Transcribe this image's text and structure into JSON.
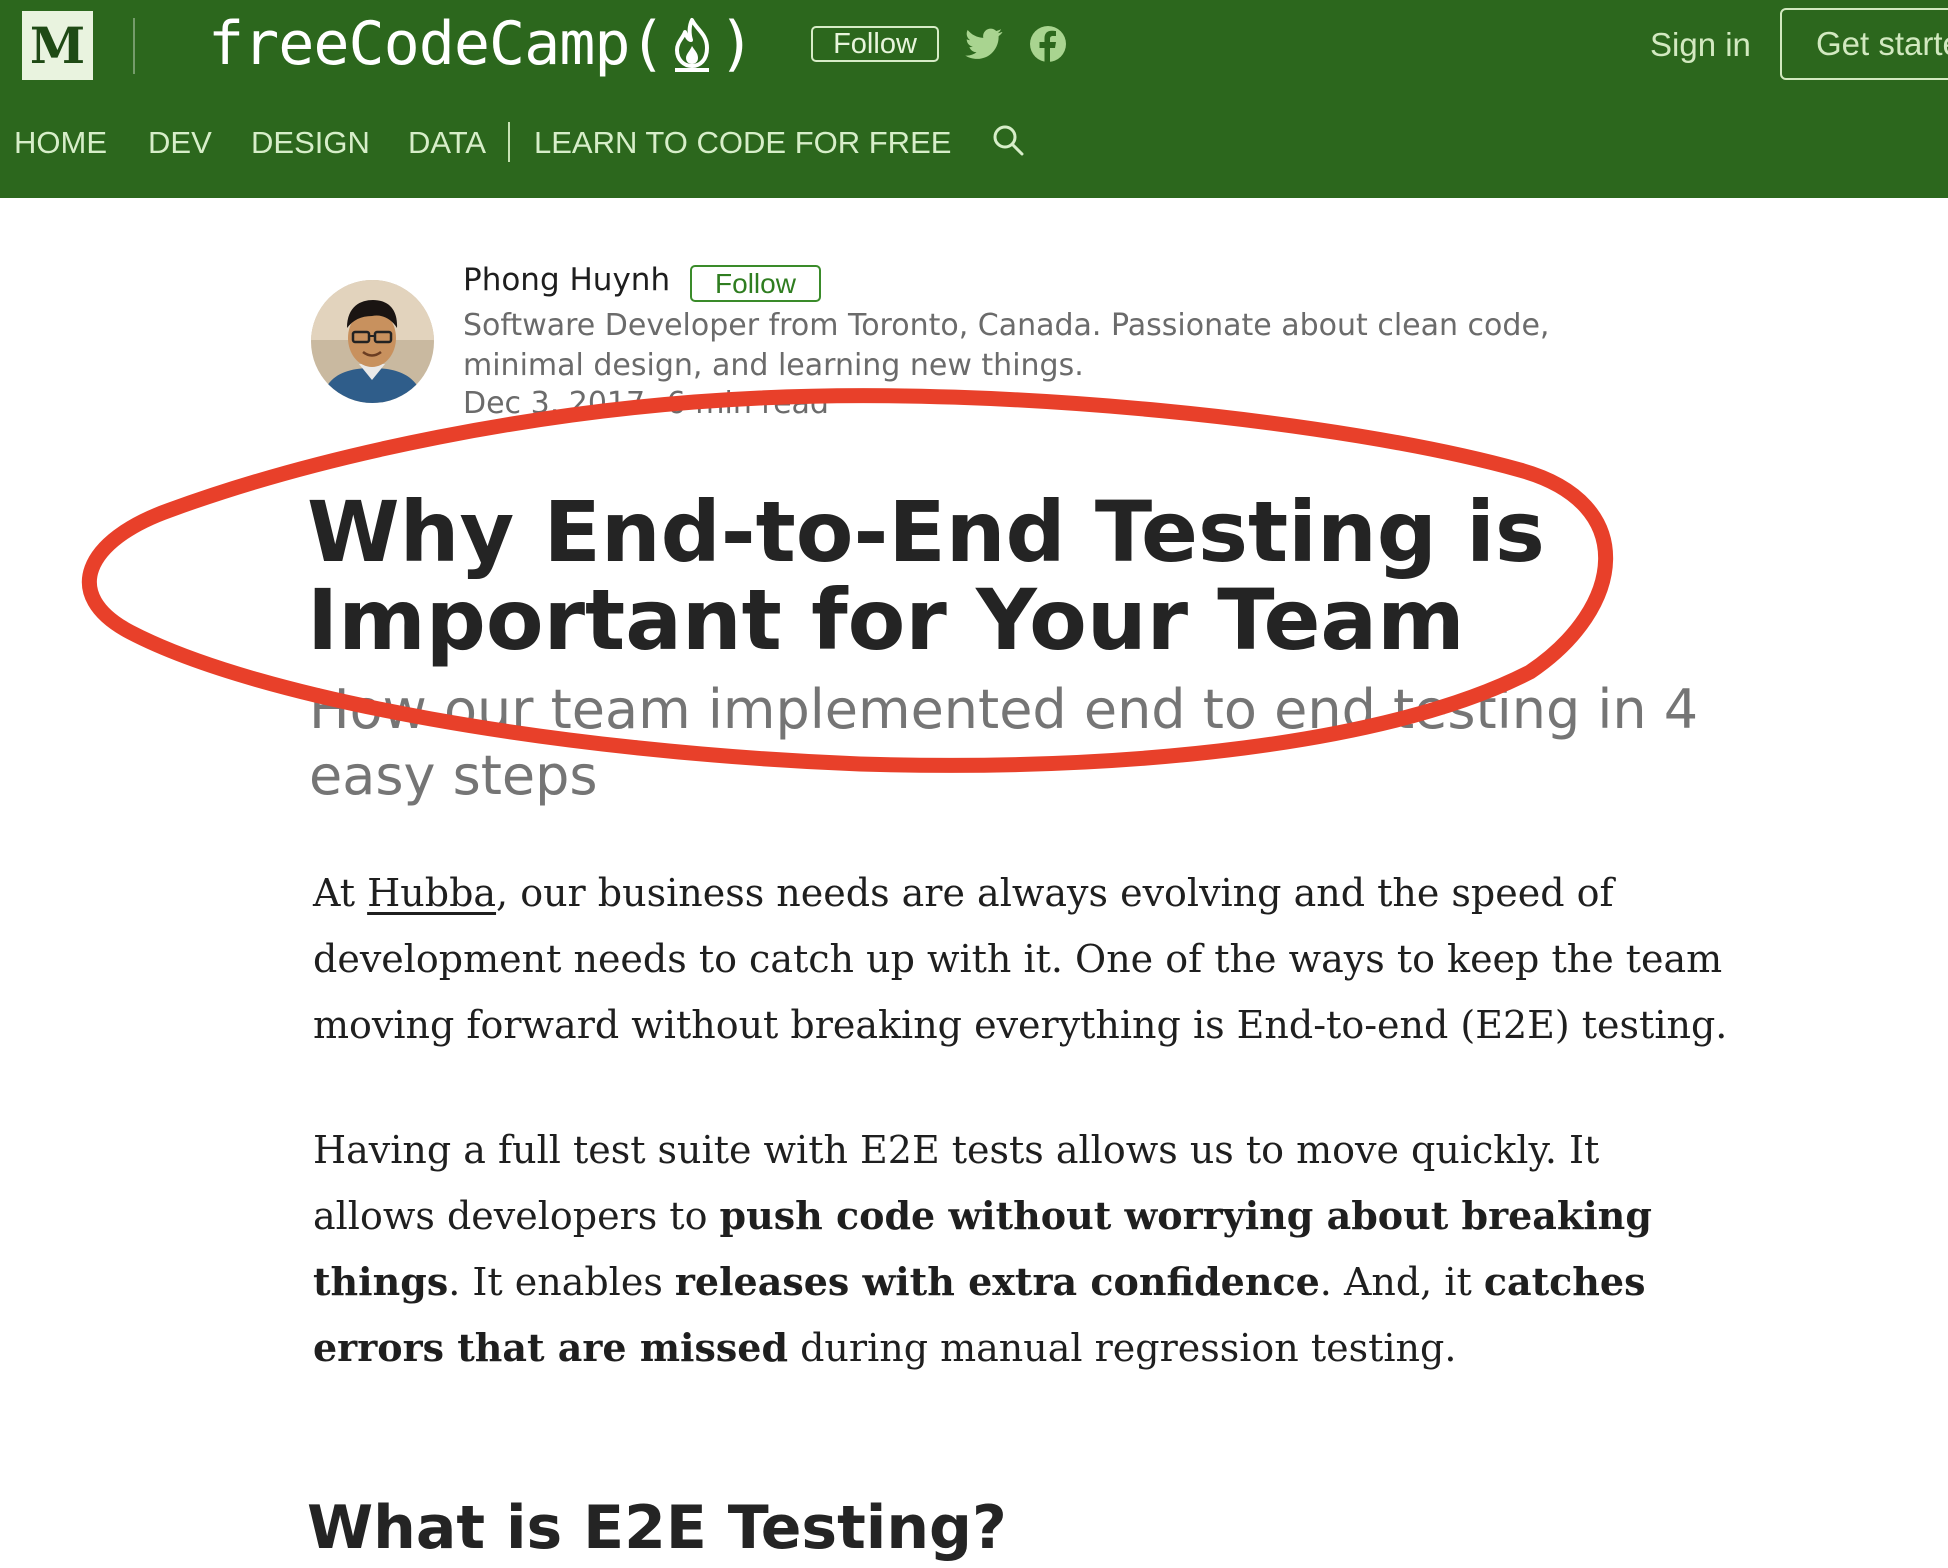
{
  "header": {
    "logo_letter": "M",
    "publication": {
      "name_prefix": "freeCodeCamp(",
      "name_suffix": ")"
    },
    "follow_label": "Follow",
    "signin_label": "Sign in",
    "get_started_label": "Get started",
    "nav": [
      {
        "label": "HOME"
      },
      {
        "label": "DEV"
      },
      {
        "label": "DESIGN"
      },
      {
        "label": "DATA"
      },
      {
        "label": "LEARN TO CODE FOR FREE"
      }
    ],
    "colors": {
      "bar": "#2c671d",
      "text": "#d7eec9"
    }
  },
  "author": {
    "name": "Phong Huynh",
    "follow_label": "Follow",
    "bio": "Software Developer from Toronto, Canada. Passionate about clean code, minimal design, and learning new things.",
    "date": "Dec 3, 2017",
    "separator": "·",
    "read_time": "6 min read"
  },
  "article": {
    "title": "Why End-to-End Testing is Important for Your Team",
    "subtitle": "How our team implemented end to end testing in 4 easy steps",
    "p1": {
      "pre": "At ",
      "link": "Hubba",
      "post": ", our business needs are always evolving and the speed of development needs to catch up with it. One of the ways to keep the team moving forward without breaking everything is End-to-end (E2E) testing."
    },
    "p2": {
      "t1": "Having a full test suite with E2E tests allows us to move quickly. It allows developers to ",
      "b1": "push code without worrying about breaking things",
      "t2": ". It enables ",
      "b2": "releases with extra confidence",
      "t3": ". And, it ",
      "b3": "catches errors that are missed",
      "t4": " during manual regression testing."
    },
    "section_heading": "What is E2E Testing?"
  },
  "annotation": {
    "color": "#e8402a"
  }
}
